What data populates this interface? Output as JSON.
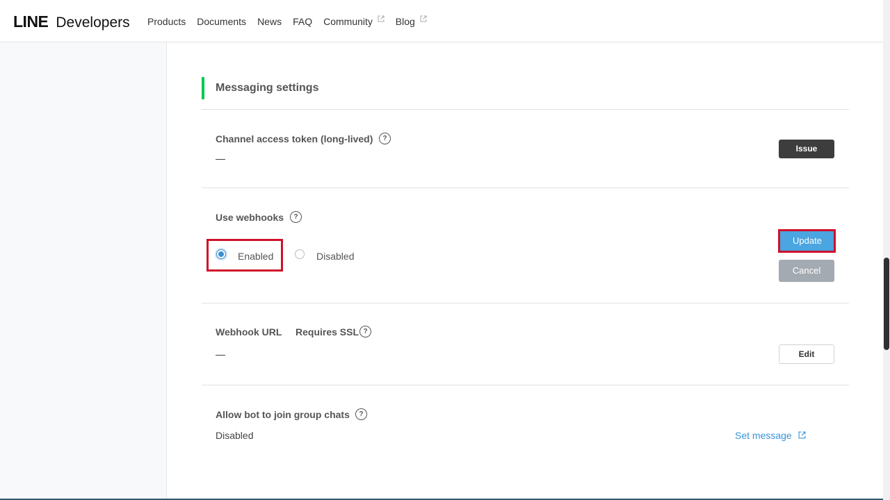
{
  "header": {
    "logo_primary": "LINE",
    "logo_secondary": "Developers",
    "nav": [
      {
        "label": "Products",
        "external": false
      },
      {
        "label": "Documents",
        "external": false
      },
      {
        "label": "News",
        "external": false
      },
      {
        "label": "FAQ",
        "external": false
      },
      {
        "label": "Community",
        "external": true
      },
      {
        "label": "Blog",
        "external": true
      }
    ]
  },
  "section": {
    "title": "Messaging settings",
    "accent_color": "#06c755"
  },
  "rows": {
    "token": {
      "label": "Channel access token (long-lived)",
      "value": "—",
      "button": "Issue"
    },
    "webhooks": {
      "label": "Use webhooks",
      "options": [
        "Enabled",
        "Disabled"
      ],
      "selected": "Enabled",
      "update_button": "Update",
      "cancel_button": "Cancel"
    },
    "webhook_url": {
      "label": "Webhook URL",
      "sublabel": "Requires SSL",
      "value": "—",
      "button": "Edit"
    },
    "group_chats": {
      "label": "Allow bot to join group chats",
      "value": "Disabled",
      "link": "Set message"
    }
  },
  "icons": {
    "help": "?",
    "external_link": "external-link-icon"
  },
  "colors": {
    "update_button": "#4aa5e0",
    "issue_button": "#3d3d3d",
    "cancel_button": "#a4aab1",
    "highlight": "#d0102a",
    "link": "#3894d6"
  }
}
